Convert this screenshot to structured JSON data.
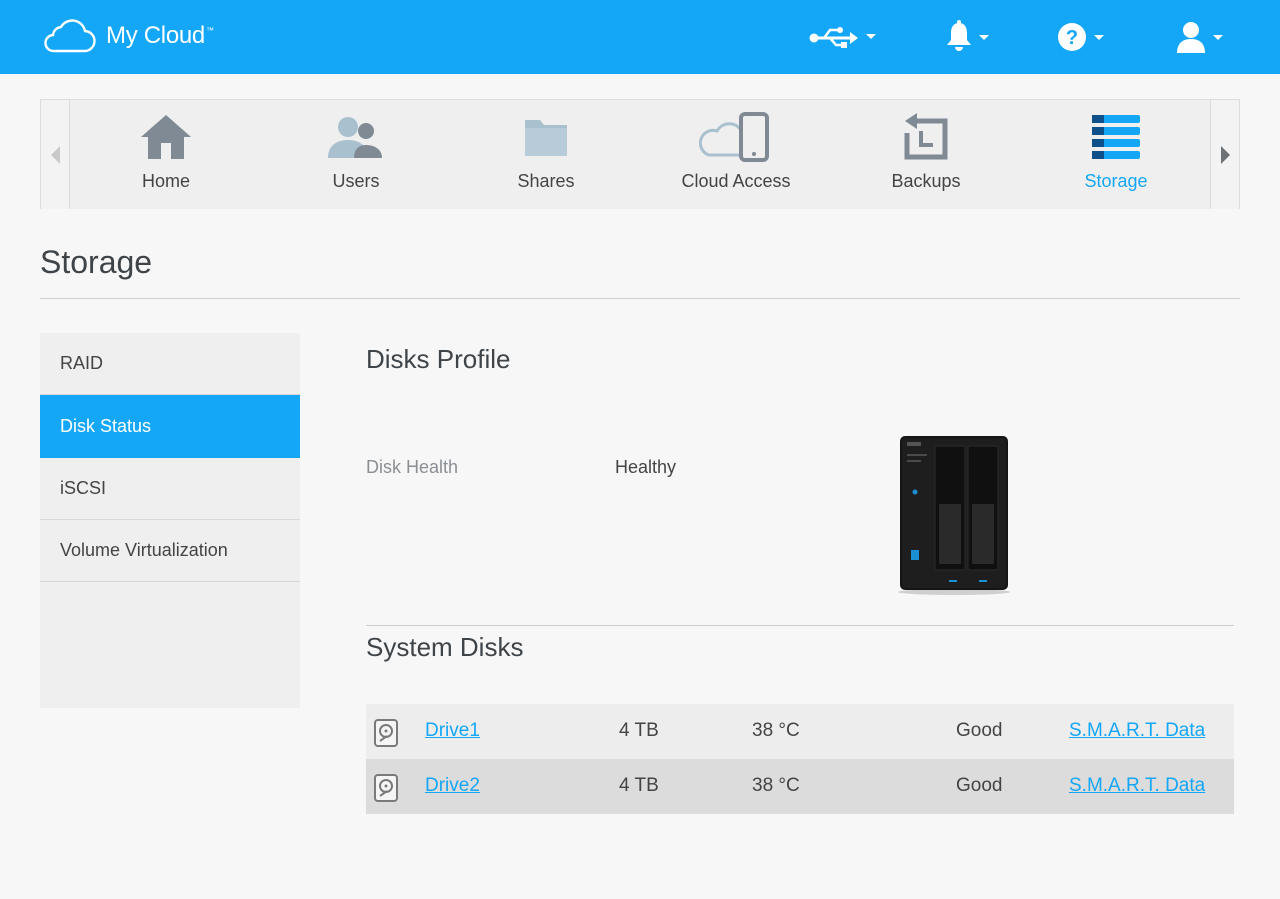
{
  "header": {
    "app_title": "My Cloud",
    "trademark": "™",
    "icons": [
      {
        "name": "usb-icon"
      },
      {
        "name": "bell-icon"
      },
      {
        "name": "help-icon"
      },
      {
        "name": "user-icon"
      }
    ],
    "brand_color": "#14a7f7"
  },
  "nav": {
    "items": [
      {
        "label": "Home",
        "icon": "home-icon"
      },
      {
        "label": "Users",
        "icon": "users-icon"
      },
      {
        "label": "Shares",
        "icon": "folder-icon"
      },
      {
        "label": "Cloud Access",
        "icon": "cloud-device-icon"
      },
      {
        "label": "Backups",
        "icon": "backup-icon"
      },
      {
        "label": "Storage",
        "icon": "storage-icon",
        "active": true
      }
    ]
  },
  "page": {
    "title": "Storage"
  },
  "sidebar": {
    "items": [
      {
        "label": "RAID"
      },
      {
        "label": "Disk Status",
        "active": true
      },
      {
        "label": "iSCSI"
      },
      {
        "label": "Volume Virtualization"
      }
    ]
  },
  "disks_profile": {
    "title": "Disks Profile",
    "health_label": "Disk Health",
    "health_value": "Healthy"
  },
  "system_disks": {
    "title": "System Disks",
    "rows": [
      {
        "name": "Drive1",
        "size": "4 TB",
        "temp": "38 °C",
        "status": "Good",
        "smart": "S.M.A.R.T. Data"
      },
      {
        "name": "Drive2",
        "size": "4 TB",
        "temp": "38 °C",
        "status": "Good",
        "smart": "S.M.A.R.T. Data"
      }
    ]
  }
}
